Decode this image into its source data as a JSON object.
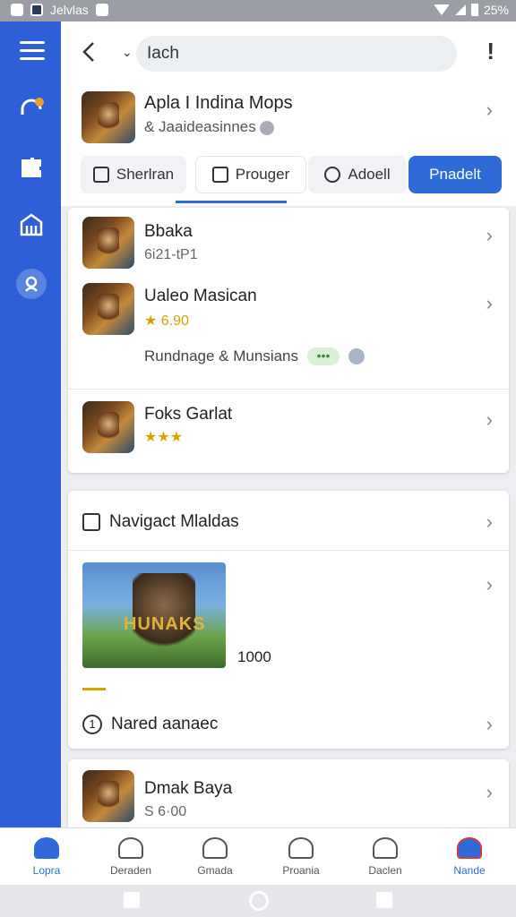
{
  "status_bar": {
    "app_name": "Jelvlas",
    "battery": "25%"
  },
  "top_bar": {
    "search_value": "Iach",
    "more": "!"
  },
  "header": {
    "title": "Apla I Indina Mops",
    "subtitle": "& Jaaideasinnes",
    "tabs": [
      {
        "label": "Sherlran"
      },
      {
        "label": "Prouger"
      },
      {
        "label": "Adoell"
      },
      {
        "label": "Pnadelt"
      }
    ]
  },
  "list1": {
    "items": [
      {
        "name": "Bbaka",
        "meta": "6i21-tP1"
      },
      {
        "name": "Ualeo Masican",
        "rating": "★ 6.90"
      },
      {
        "name": "Foks Garlat",
        "rating": "★★★"
      }
    ],
    "tagline": "Rundnage & Munsians",
    "tag_pill": "•••"
  },
  "section2": {
    "title": "Navigact Mlaldas",
    "banner_logo": "HUNAKS",
    "banner_count": "1000",
    "footer_label": "Nared aanaec"
  },
  "list3": {
    "items": [
      {
        "name": "Dmak Baya",
        "meta": "S 6·00"
      }
    ]
  },
  "bottom_nav": [
    {
      "label": "Lopra"
    },
    {
      "label": "Deraden"
    },
    {
      "label": "Gmada"
    },
    {
      "label": "Proania"
    },
    {
      "label": "Daclen"
    },
    {
      "label": "Nande"
    }
  ],
  "colors": {
    "accent": "#2f6bd8",
    "sidebar": "#2f5fd6",
    "rating": "#d4a400"
  }
}
